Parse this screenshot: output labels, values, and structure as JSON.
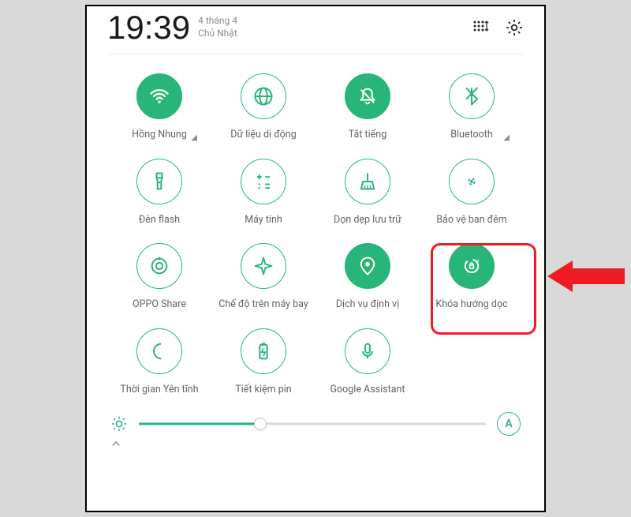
{
  "status": {
    "time": "19:39",
    "date_line1": "4 tháng 4",
    "date_line2": "Chủ Nhật"
  },
  "tiles": [
    {
      "label": "Hồng Nhung",
      "icon": "wifi-icon",
      "active": true,
      "expandable": true
    },
    {
      "label": "Dữ liệu di động",
      "icon": "globe-icon",
      "active": false,
      "expandable": false
    },
    {
      "label": "Tắt tiếng",
      "icon": "bell-off-icon",
      "active": true,
      "expandable": false
    },
    {
      "label": "Bluetooth",
      "icon": "bluetooth-icon",
      "active": false,
      "expandable": true
    },
    {
      "label": "Đèn flash",
      "icon": "flashlight-icon",
      "active": false,
      "expandable": false
    },
    {
      "label": "Máy tính",
      "icon": "calculator-icon",
      "active": false,
      "expandable": false
    },
    {
      "label": "Dọn dẹp lưu trữ",
      "icon": "broom-icon",
      "active": false,
      "expandable": false
    },
    {
      "label": "Bảo vệ ban đêm",
      "icon": "eye-protect-icon",
      "active": false,
      "expandable": false
    },
    {
      "label": "OPPO Share",
      "icon": "share-icon",
      "active": false,
      "expandable": false
    },
    {
      "label": "Chế độ trên máy bay",
      "icon": "airplane-icon",
      "active": false,
      "expandable": false
    },
    {
      "label": "Dịch vụ định vị",
      "icon": "location-icon",
      "active": true,
      "expandable": false
    },
    {
      "label": "Khóa hướng dọc",
      "icon": "rotation-lock-icon",
      "active": true,
      "expandable": false
    },
    {
      "label": "Thời gian Yên tĩnh",
      "icon": "moon-icon",
      "active": false,
      "expandable": false
    },
    {
      "label": "Tiết kiệm pin",
      "icon": "battery-saver-icon",
      "active": false,
      "expandable": false
    },
    {
      "label": "Google Assistant",
      "icon": "mic-icon",
      "active": false,
      "expandable": false
    }
  ],
  "brightness": {
    "percent": 35,
    "auto_label": "A"
  },
  "highlight_index": 11
}
